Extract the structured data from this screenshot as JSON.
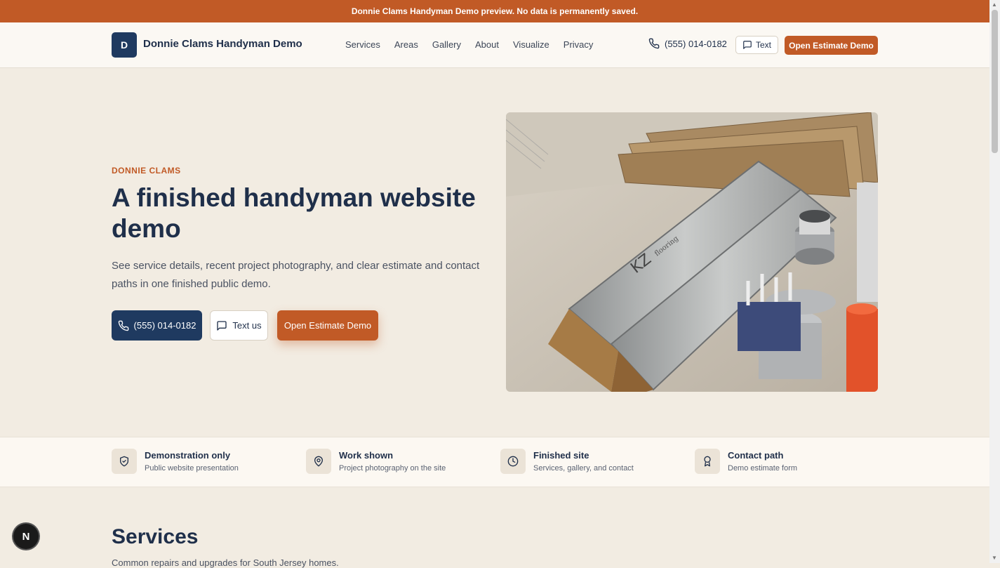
{
  "banner": {
    "text": "Donnie Clams Handyman Demo preview. No data is permanently saved."
  },
  "header": {
    "logo_letter": "D",
    "brand": "Donnie Clams Handyman Demo",
    "nav": [
      "Services",
      "Areas",
      "Gallery",
      "About",
      "Visualize",
      "Privacy"
    ],
    "phone": "(555) 014-0182",
    "text_label": "Text",
    "estimate_label": "Open Estimate Demo"
  },
  "hero": {
    "eyebrow": "DONNIE CLAMS",
    "title": "A finished handyman website demo",
    "description": "See service details, recent project photography, and clear estimate and contact paths in one finished public demo.",
    "call_label": "(555) 014-0182",
    "text_label": "Text us",
    "estimate_label": "Open Estimate Demo",
    "photo_icon": "flooring-boxes-photo"
  },
  "trust": [
    {
      "icon": "shield-check-icon",
      "title": "Demonstration only",
      "subtitle": "Public website presentation"
    },
    {
      "icon": "map-pin-icon",
      "title": "Work shown",
      "subtitle": "Project photography on the site"
    },
    {
      "icon": "clock-icon",
      "title": "Finished site",
      "subtitle": "Services, gallery, and contact"
    },
    {
      "icon": "award-icon",
      "title": "Contact path",
      "subtitle": "Demo estimate form"
    }
  ],
  "services": {
    "title": "Services",
    "subtitle": "Common repairs and upgrades for South Jersey homes."
  },
  "dev_badge": {
    "letter": "N"
  },
  "colors": {
    "accent": "#c15a26",
    "navy": "#1f3a60",
    "background": "#f2ece2"
  }
}
